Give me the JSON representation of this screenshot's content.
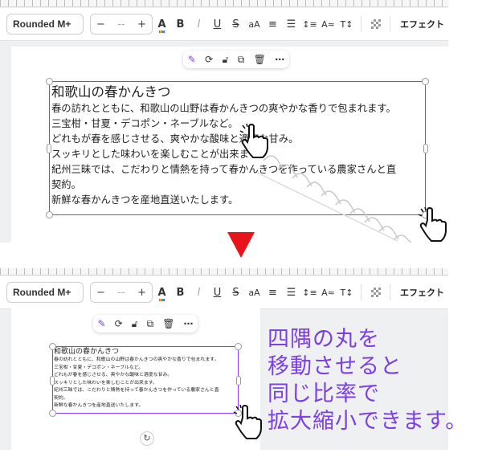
{
  "toolbar": {
    "font_name": "Rounded M+",
    "size_minus": "−",
    "size_value": "--",
    "size_plus": "+",
    "effects_label": "エフェクト"
  },
  "icons": {
    "text_color": "A",
    "bold": "B",
    "italic": "I",
    "underline": "U",
    "strikethrough": "S",
    "case": "aA",
    "align": "≡",
    "list": "☰",
    "spacing": "↕≡",
    "text_style": "A≈",
    "vertical_text": "T↕",
    "transparency": "checker"
  },
  "textbox": {
    "title": "和歌山の春かんきつ",
    "lines": [
      "春の訪れとともに、和歌山の山野は春かんきつの爽やかな香りで包まれます。",
      "三宝柑・甘夏・デコポン・ネーブルなど。",
      "どれもが春を感じさせる、爽やかな酸味と適度な甘み。",
      "スッキリとした味わいを楽しむことが出来ます。",
      "紀州三昧では、こだわりと情熱を持って春かんきつを作っている農家さんと直",
      "契約。",
      "新鮮な春かんきつを産地直送いたします。"
    ]
  },
  "float_actions": [
    "magic-edit",
    "comment",
    "lock",
    "duplicate",
    "delete",
    "more"
  ],
  "caption": {
    "lines": [
      "四隅の丸を",
      "移動させると",
      "同じ比率で",
      "拡大縮小できます。"
    ]
  },
  "colors": {
    "selection": "#8b3dff",
    "arrow": "#e8141c",
    "caption": "#7b3fe4"
  }
}
